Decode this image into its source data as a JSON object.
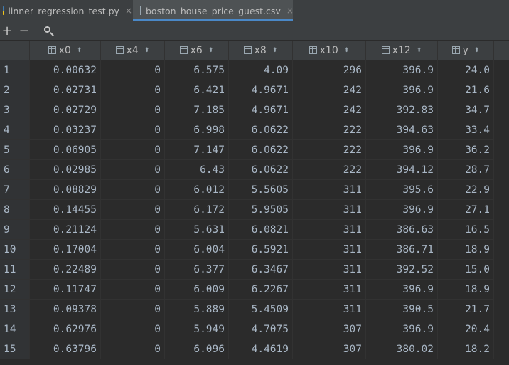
{
  "tabs": [
    {
      "label": "linner_regression_test.py",
      "icon": "python-file-icon"
    },
    {
      "label": "boston_house_price_guest.csv",
      "icon": "csv-file-icon",
      "active": true
    }
  ],
  "tab_close_glyph": "×",
  "toolbar": {
    "add_glyph": "+",
    "remove_glyph": "−"
  },
  "table": {
    "columns": [
      "x0",
      "x4",
      "x6",
      "x8",
      "x10",
      "x12",
      "y"
    ],
    "sort_glyph": "⬍",
    "rows": [
      {
        "n": "1",
        "cells": [
          "0.00632",
          "0",
          "6.575",
          "4.09",
          "296",
          "396.9",
          "24.0"
        ]
      },
      {
        "n": "2",
        "cells": [
          "0.02731",
          "0",
          "6.421",
          "4.9671",
          "242",
          "396.9",
          "21.6"
        ]
      },
      {
        "n": "3",
        "cells": [
          "0.02729",
          "0",
          "7.185",
          "4.9671",
          "242",
          "392.83",
          "34.7"
        ]
      },
      {
        "n": "4",
        "cells": [
          "0.03237",
          "0",
          "6.998",
          "6.0622",
          "222",
          "394.63",
          "33.4"
        ]
      },
      {
        "n": "5",
        "cells": [
          "0.06905",
          "0",
          "7.147",
          "6.0622",
          "222",
          "396.9",
          "36.2"
        ]
      },
      {
        "n": "6",
        "cells": [
          "0.02985",
          "0",
          "6.43",
          "6.0622",
          "222",
          "394.12",
          "28.7"
        ]
      },
      {
        "n": "7",
        "cells": [
          "0.08829",
          "0",
          "6.012",
          "5.5605",
          "311",
          "395.6",
          "22.9"
        ]
      },
      {
        "n": "8",
        "cells": [
          "0.14455",
          "0",
          "6.172",
          "5.9505",
          "311",
          "396.9",
          "27.1"
        ]
      },
      {
        "n": "9",
        "cells": [
          "0.21124",
          "0",
          "5.631",
          "6.0821",
          "311",
          "386.63",
          "16.5"
        ]
      },
      {
        "n": "10",
        "cells": [
          "0.17004",
          "0",
          "6.004",
          "6.5921",
          "311",
          "386.71",
          "18.9"
        ]
      },
      {
        "n": "11",
        "cells": [
          "0.22489",
          "0",
          "6.377",
          "6.3467",
          "311",
          "392.52",
          "15.0"
        ]
      },
      {
        "n": "12",
        "cells": [
          "0.11747",
          "0",
          "6.009",
          "6.2267",
          "311",
          "396.9",
          "18.9"
        ]
      },
      {
        "n": "13",
        "cells": [
          "0.09378",
          "0",
          "5.889",
          "5.4509",
          "311",
          "390.5",
          "21.7"
        ]
      },
      {
        "n": "14",
        "cells": [
          "0.62976",
          "0",
          "5.949",
          "4.7075",
          "307",
          "396.9",
          "20.4"
        ]
      },
      {
        "n": "15",
        "cells": [
          "0.63796",
          "0",
          "6.096",
          "4.4619",
          "307",
          "380.02",
          "18.2"
        ]
      }
    ]
  },
  "colors": {
    "background": "#2b2b2b",
    "panel": "#3c3f41",
    "accent": "#4a88c7",
    "text": "#a9b7c6"
  }
}
